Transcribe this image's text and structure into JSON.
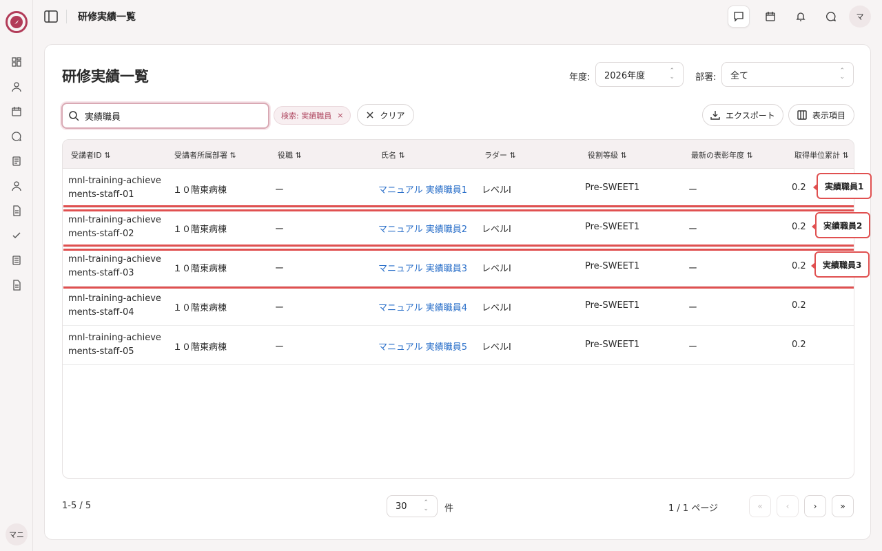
{
  "topbar": {
    "breadcrumb": "研修実績一覧",
    "avatar": "マ"
  },
  "sidebar": {
    "user": "マニ"
  },
  "page": {
    "title": "研修実績一覧"
  },
  "filters": {
    "year_label": "年度:",
    "year_value": "2026年度",
    "dept_label": "部署:",
    "dept_value": "全て"
  },
  "search": {
    "value": "実績職員"
  },
  "chip": {
    "label": "検索: 実績職員"
  },
  "buttons": {
    "clear": "クリア",
    "export": "エクスポート",
    "columns": "表示項目"
  },
  "table": {
    "headers": [
      "受講者ID",
      "受講者所属部署",
      "役職",
      "氏名",
      "ラダー",
      "役割等級",
      "最新の表彰年度",
      "取得単位累計"
    ],
    "sort_glyph": "⇅",
    "rows": [
      {
        "id": "mnl-training-achievements-staff-01",
        "dept": "１０階東病棟",
        "position": "ー",
        "name": "マニュアル 実績職員1",
        "ladder": "レベルI",
        "grade": "Pre-SWEET1",
        "award": "ー",
        "units": "0.2"
      },
      {
        "id": "mnl-training-achievements-staff-02",
        "dept": "１０階東病棟",
        "position": "ー",
        "name": "マニュアル 実績職員2",
        "ladder": "レベルI",
        "grade": "Pre-SWEET1",
        "award": "ー",
        "units": "0.2"
      },
      {
        "id": "mnl-training-achievements-staff-03",
        "dept": "１０階東病棟",
        "position": "ー",
        "name": "マニュアル 実績職員3",
        "ladder": "レベルI",
        "grade": "Pre-SWEET1",
        "award": "ー",
        "units": "0.2"
      },
      {
        "id": "mnl-training-achievements-staff-04",
        "dept": "１０階東病棟",
        "position": "ー",
        "name": "マニュアル 実績職員4",
        "ladder": "レベルI",
        "grade": "Pre-SWEET1",
        "award": "ー",
        "units": "0.2"
      },
      {
        "id": "mnl-training-achievements-staff-05",
        "dept": "１０階東病棟",
        "position": "ー",
        "name": "マニュアル 実績職員5",
        "ladder": "レベルI",
        "grade": "Pre-SWEET1",
        "award": "ー",
        "units": "0.2"
      }
    ]
  },
  "annotations": [
    "実績職員1",
    "実績職員2",
    "実績職員3"
  ],
  "pagination": {
    "count": "1-5 / 5",
    "per_page": "30",
    "unit": "件",
    "page_info": "1 / 1 ページ"
  },
  "colors": {
    "accent": "#b23b58",
    "highlight": "#e05050",
    "link": "#2a6fc9"
  }
}
